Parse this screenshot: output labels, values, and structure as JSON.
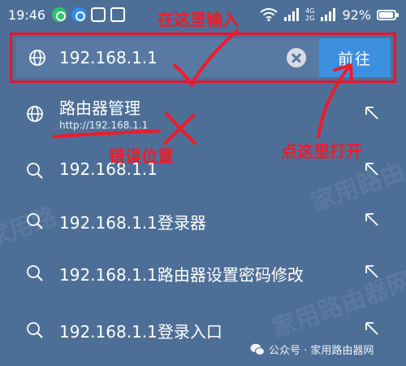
{
  "status_bar": {
    "time": "19:46",
    "net_top": "4G",
    "net_bottom": "2G",
    "battery": "92%"
  },
  "address_bar": {
    "url_value": "192.168.1.1",
    "go_label": "前往"
  },
  "suggestions": [
    {
      "title": "路由器管理",
      "subtitle": "http://192.168.1.1"
    },
    {
      "title": "192.168.1.1"
    },
    {
      "title": "192.168.1.1登录器"
    },
    {
      "title": "192.168.1.1路由器设置密码修改"
    },
    {
      "title": "192.168.1.1登录入口"
    }
  ],
  "annotations": {
    "input_here": "在这里输入",
    "wrong_position": "错误位置",
    "click_here": "点这里打开"
  },
  "footer": {
    "source": "公众号 · 家用路由器网"
  },
  "colors": {
    "background": "#4d6f97",
    "accent": "#3d8fe0",
    "annotation": "#f01a2a"
  }
}
